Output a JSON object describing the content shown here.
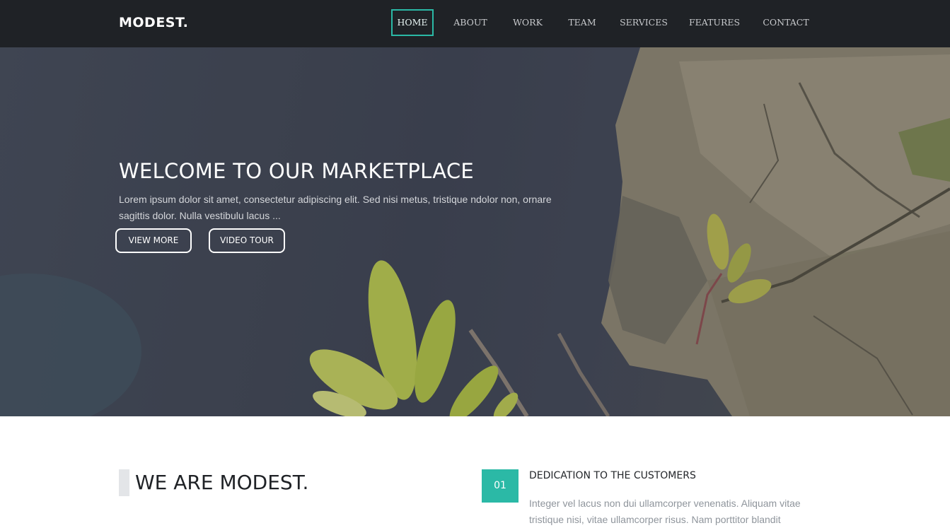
{
  "brand": {
    "logo": "MODEST."
  },
  "nav": {
    "items": [
      {
        "label": "HOME",
        "active": true
      },
      {
        "label": "ABOUT"
      },
      {
        "label": "WORK"
      },
      {
        "label": "TEAM"
      },
      {
        "label": "SERVICES"
      },
      {
        "label": "FEATURES"
      },
      {
        "label": "CONTACT"
      }
    ]
  },
  "hero": {
    "title": "WELCOME TO OUR MARKETPLACE",
    "text": "Lorem ipsum dolor sit amet, consectetur adipiscing elit. Sed nisi metus, tristique ndolor non, ornare sagittis dolor. Nulla vestibulu lacus ...",
    "buttons": [
      "VIEW MORE",
      "VIDEO TOUR"
    ]
  },
  "about": {
    "title": "WE ARE MODEST.",
    "feature": {
      "number": "01",
      "title": "DEDICATION TO THE CUSTOMERS",
      "text": "Integer vel lacus non dui ullamcorper venenatis. Aliquam vitae tristique nisi, vitae ullamcorper risus. Nam porttitor blandit"
    }
  },
  "colors": {
    "accent": "#2bb9a6",
    "navbar": "#1f2226",
    "hero_overlay": "#3a3f4c"
  }
}
